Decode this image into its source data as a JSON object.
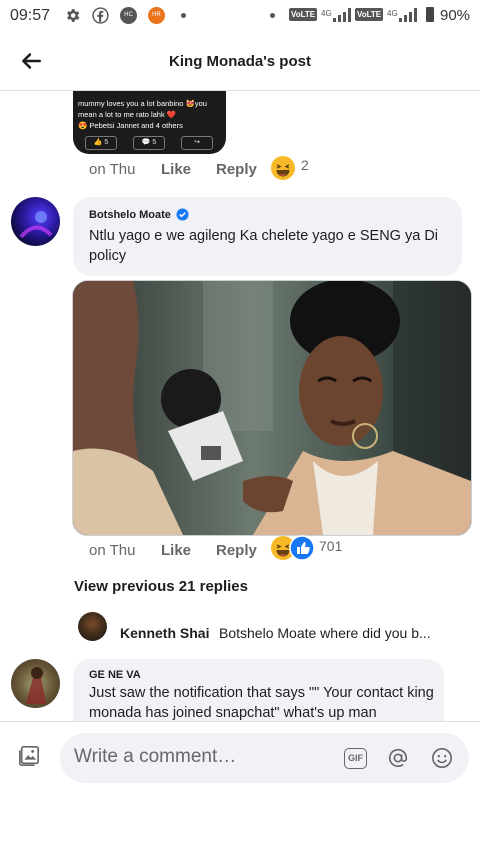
{
  "status_bar": {
    "time": "09:57",
    "icons": [
      "settings-icon",
      "facebook-icon",
      "hc-icon",
      "hr-icon",
      "dot-icon"
    ],
    "hc_label": "HC",
    "hr_label": "HR",
    "volte1": "VoLTE",
    "net1": "4G",
    "volte2": "VoLTE",
    "net2": "4G",
    "battery": "90%"
  },
  "header": {
    "title": "King Monada's post"
  },
  "quoted_card": {
    "line1": "mummy loves you a lot banbino 😻you",
    "line2": "mean a lot to me rato lahk ❤️",
    "line3": "😍 Pebetsi Jannet and 4 others",
    "likes": "5",
    "comments": "5"
  },
  "row1": {
    "time": "on Thu",
    "like": "Like",
    "reply": "Reply",
    "reaction_count": "2"
  },
  "comment1": {
    "name": "Botshelo Moate",
    "text": "Ntlu yago e we agileng Ka chelete yago e SENG ya Di policy"
  },
  "row2": {
    "time": "on Thu",
    "like": "Like",
    "reply": "Reply",
    "reaction_count": "701"
  },
  "view_previous": "View previous 21 replies",
  "reply_preview": {
    "name": "Kenneth Shai",
    "text": "Botshelo Moate where did you b..."
  },
  "comment2": {
    "name": "GE NE VA",
    "text": "Just saw the notification that says \"\" Your contact king monada has joined snapchat\" what's up man"
  },
  "composer": {
    "placeholder": "Write a comment…",
    "gif": "GIF"
  },
  "colors": {
    "verified": "#1877f2",
    "haha": "#f7b928",
    "like_blue": "#1877f2"
  }
}
